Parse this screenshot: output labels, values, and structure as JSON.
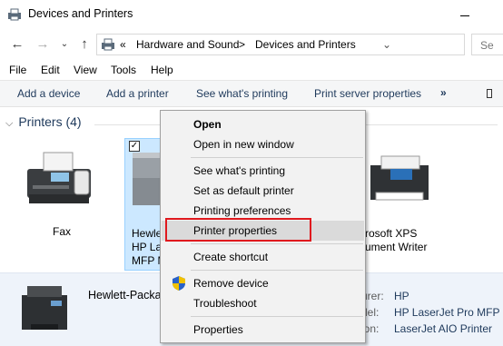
{
  "window": {
    "title": "Devices and Printers"
  },
  "address": {
    "overflow": "«",
    "crumbs": [
      "Hardware and Sound",
      "Devices and Printers"
    ],
    "separator": ">",
    "chevron": "⌄",
    "search_placeholder": "Se"
  },
  "menubar": [
    "File",
    "Edit",
    "View",
    "Tools",
    "Help"
  ],
  "commandbar": {
    "items": [
      "Add a device",
      "Add a printer",
      "See what's printing",
      "Print server properties"
    ],
    "more": "»"
  },
  "group": {
    "title": "Printers (4)"
  },
  "devices": [
    {
      "label": "Fax"
    },
    {
      "label_lines": [
        "Hewle",
        "HP La",
        "MFP M"
      ]
    },
    {
      "label_lines": [
        "rosoft XPS",
        "ument Writer"
      ]
    }
  ],
  "details": {
    "name": "Hewlett-Packa",
    "rows": [
      {
        "key": "urer:",
        "value": "HP"
      },
      {
        "key": "del:",
        "value": "HP LaserJet Pro MFP"
      },
      {
        "key": "ion:",
        "value": "LaserJet AIO Printer"
      }
    ]
  },
  "context_menu": {
    "items": [
      {
        "label": "Open",
        "bold": true
      },
      {
        "label": "Open in new window"
      },
      {
        "label": "See what's printing"
      },
      {
        "label": "Set as default printer"
      },
      {
        "label": "Printing preferences"
      },
      {
        "label": "Printer properties",
        "highlighted": true
      },
      {
        "label": "Create shortcut"
      },
      {
        "label": "Remove device",
        "icon": "uac-shield-icon"
      },
      {
        "label": "Troubleshoot"
      },
      {
        "label": "Properties"
      }
    ]
  },
  "colors": {
    "highlight_box": "#e0191e",
    "selection": "#cce8ff",
    "link_text": "#1e395b"
  }
}
